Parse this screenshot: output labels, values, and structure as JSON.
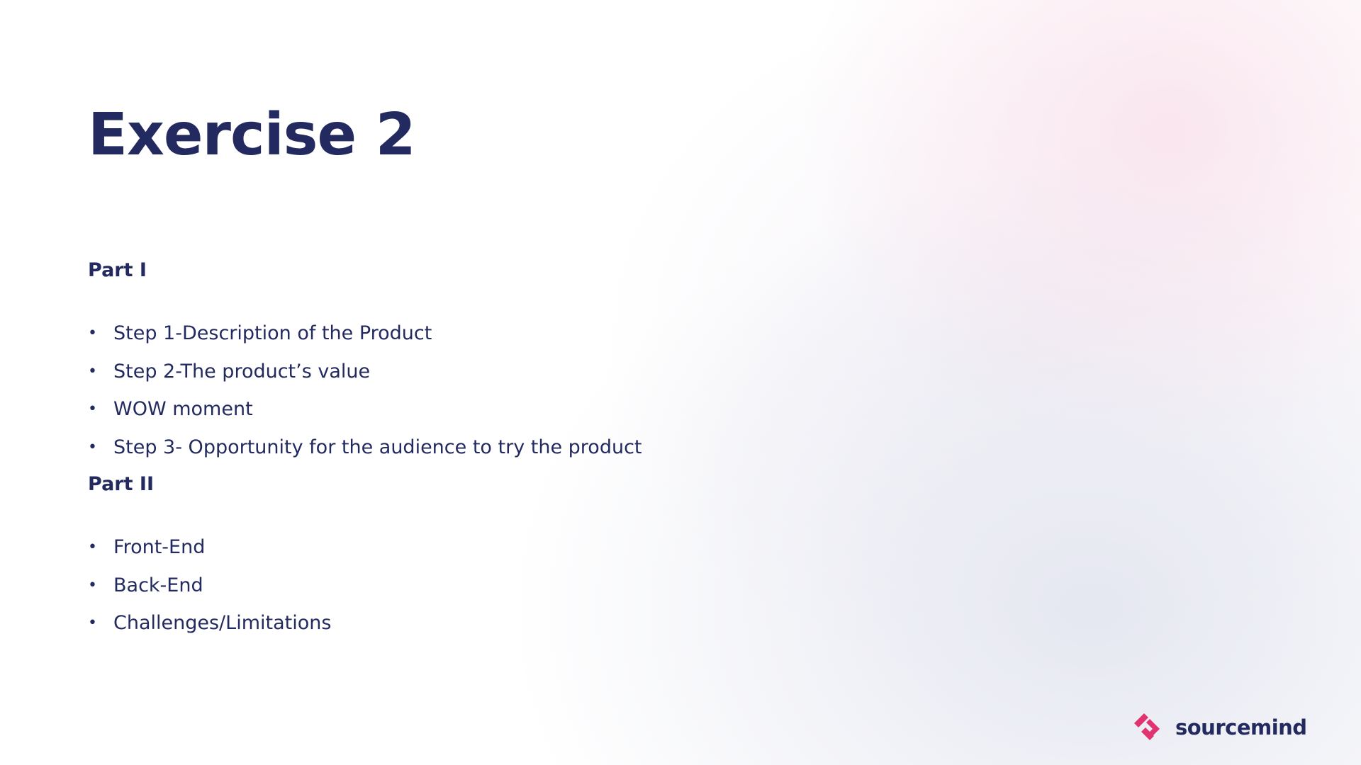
{
  "slide": {
    "title": "Exercise 2",
    "part1": {
      "heading": "Part I",
      "items": [
        "Step 1-Description of the Product",
        "Step 2-The product’s value",
        "WOW moment",
        "Step 3- Opportunity for the audience to try the product"
      ]
    },
    "part2": {
      "heading": "Part II",
      "items": [
        "Front-End",
        "Back-End",
        "Challenges/Limitations"
      ]
    },
    "bullet_char": "•"
  },
  "logo": {
    "text": "sourcemind",
    "icon": "sourcemind-chevron-logo-icon",
    "mark_color": "#e0336f",
    "text_color": "#232a5f"
  },
  "colors": {
    "text": "#232a5f",
    "accent": "#e0336f"
  }
}
